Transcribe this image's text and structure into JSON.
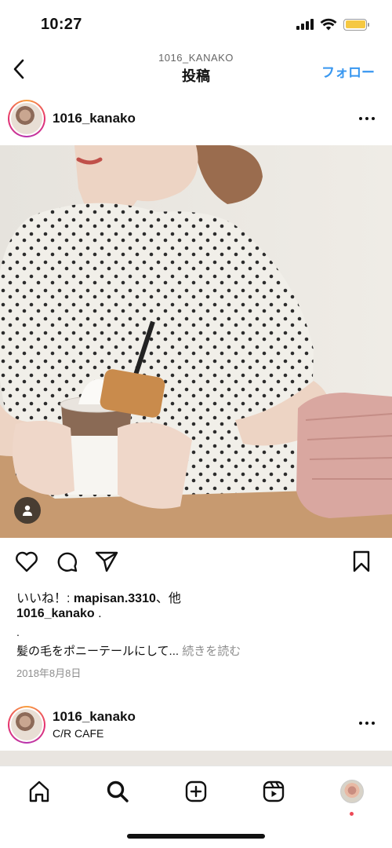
{
  "status_bar": {
    "time": "10:27",
    "battery_color": "#f5c842",
    "icons": [
      "signal-icon",
      "wifi-icon",
      "battery-icon"
    ]
  },
  "nav": {
    "subtitle": "1016_KANAKO",
    "title": "投稿",
    "follow_label": "フォロー",
    "follow_color": "#3897f0"
  },
  "post": {
    "username": "1016_kanako",
    "likes_prefix": "いいね！: ",
    "likes_user": "mapisan.3310",
    "likes_suffix": "、他",
    "caption_user": "1016_kanako",
    "caption_user_suffix": " .",
    "caption_dot": ".",
    "caption_text": "髪の毛をポニーテールにして...",
    "caption_more": "続きを読む",
    "date": "2018年8月8日"
  },
  "post2": {
    "username": "1016_kanako",
    "location": "C/R CAFE"
  },
  "tab_bar": {
    "items": [
      "home-icon",
      "search-icon",
      "create-icon",
      "reels-icon",
      "profile-avatar"
    ],
    "notification_color": "#ed4956"
  }
}
